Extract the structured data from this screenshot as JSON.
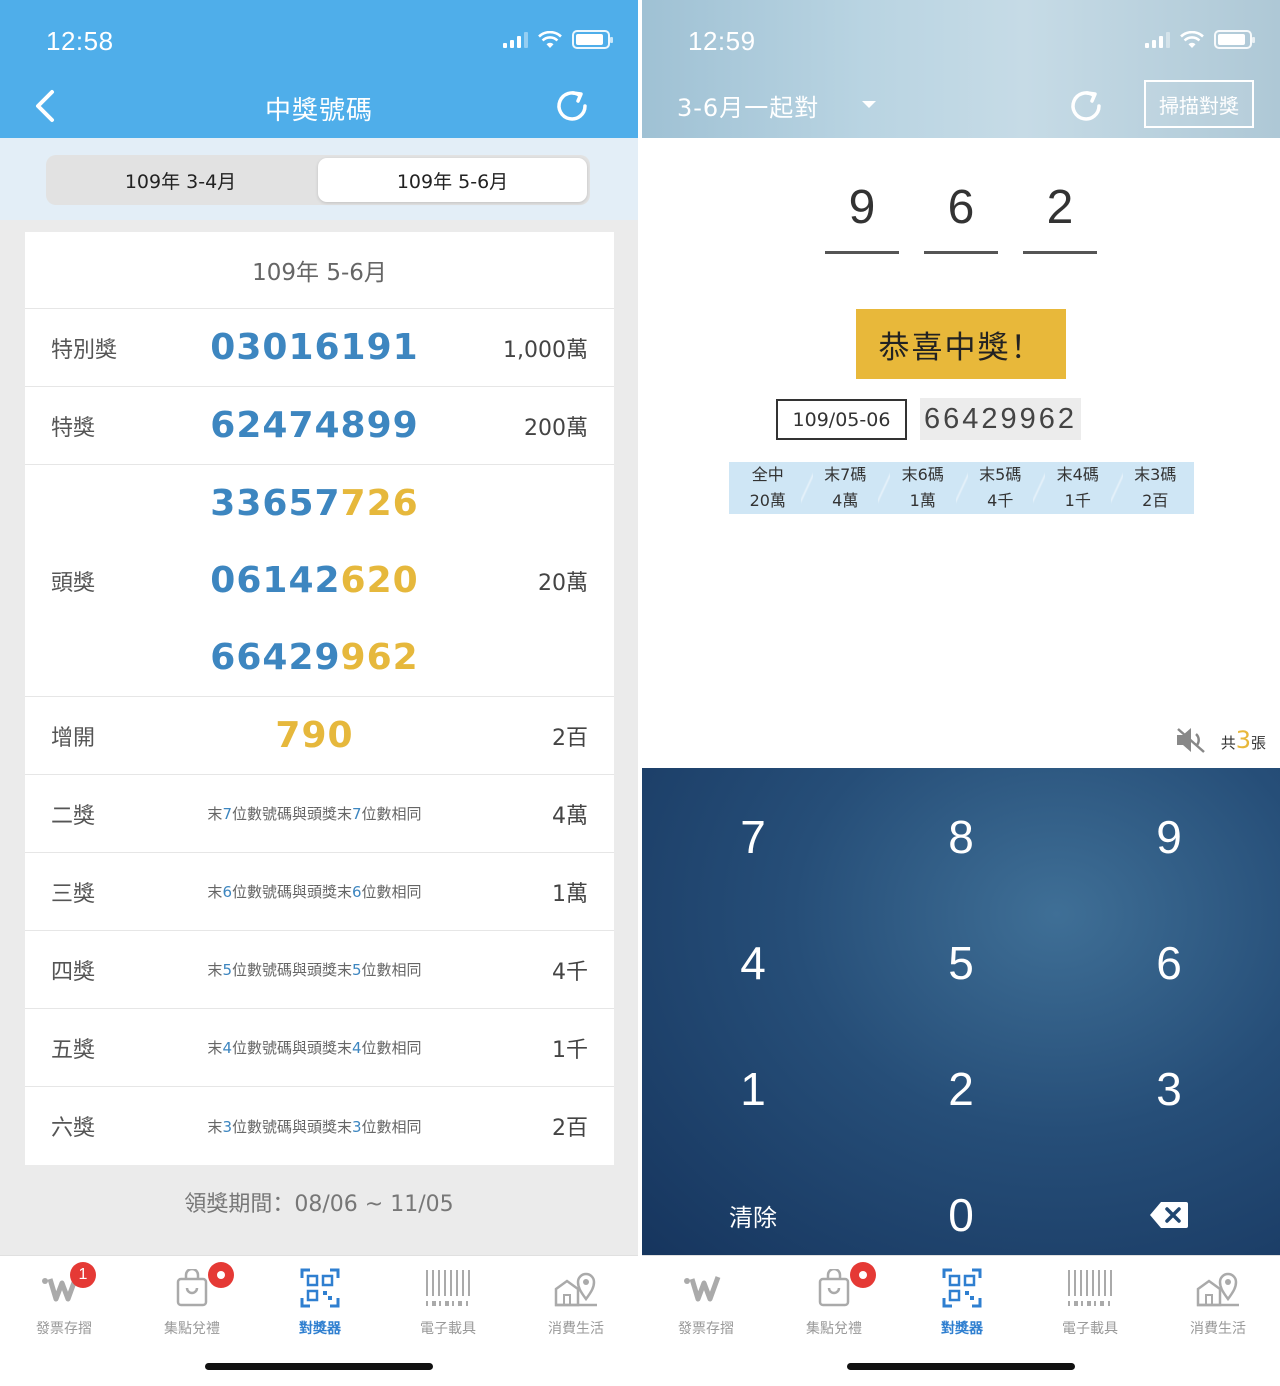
{
  "left": {
    "status_time": "12:58",
    "title": "中獎號碼",
    "segments": [
      "109年 3-4月",
      "109年 5-6月"
    ],
    "period_header": "109年 5-6月",
    "special_prize": {
      "name": "特別獎",
      "number": "03016191",
      "amount": "1,000萬"
    },
    "grand_prize": {
      "name": "特獎",
      "number": "62474899",
      "amount": "200萬"
    },
    "first_prize": {
      "name": "頭獎",
      "amount": "20萬",
      "numbers": [
        {
          "head": "33657",
          "tail": "726"
        },
        {
          "head": "06142",
          "tail": "620"
        },
        {
          "head": "66429",
          "tail": "962"
        }
      ]
    },
    "extra_prize": {
      "name": "增開",
      "number": "790",
      "amount": "2百"
    },
    "desc_prefix": "末",
    "desc_middle": "位數號碼與頭獎末",
    "desc_suffix": "位數相同",
    "lower_prizes": [
      {
        "name": "二獎",
        "digits": "7",
        "amount": "4萬"
      },
      {
        "name": "三獎",
        "digits": "6",
        "amount": "1萬"
      },
      {
        "name": "四獎",
        "digits": "5",
        "amount": "4千"
      },
      {
        "name": "五獎",
        "digits": "4",
        "amount": "1千"
      },
      {
        "name": "六獎",
        "digits": "3",
        "amount": "2百"
      }
    ],
    "claim_period": "領獎期間：08/06 ~ 11/05"
  },
  "right": {
    "status_time": "12:59",
    "period_select": "3-6月一起對",
    "scan_button": "掃描對獎",
    "entered_digits": [
      "9",
      "6",
      "2"
    ],
    "win_banner": "恭喜中獎！",
    "ticket_period": "109/05-06",
    "ticket_number": "66429962",
    "prize_table": [
      {
        "label": "全中",
        "value": "20萬"
      },
      {
        "label": "末7碼",
        "value": "4萬"
      },
      {
        "label": "末6碼",
        "value": "1萬"
      },
      {
        "label": "末5碼",
        "value": "4千"
      },
      {
        "label": "末4碼",
        "value": "1千"
      },
      {
        "label": "末3碼",
        "value": "2百"
      }
    ],
    "counter_prefix": "共",
    "counter_count": "3",
    "counter_suffix": "張",
    "keypad": [
      "7",
      "8",
      "9",
      "4",
      "5",
      "6",
      "1",
      "2",
      "3",
      "清除",
      "0"
    ]
  },
  "tabbar": {
    "tabs": [
      {
        "label": "發票存摺",
        "icon": "invoice-w-icon"
      },
      {
        "label": "集點兌禮",
        "icon": "shopping-bag-icon"
      },
      {
        "label": "對獎器",
        "icon": "qr-scan-icon"
      },
      {
        "label": "電子載具",
        "icon": "barcode-icon"
      },
      {
        "label": "消費生活",
        "icon": "map-pin-icon"
      }
    ],
    "badge_count": "1",
    "active_color": "#2f7fd0"
  },
  "colors": {
    "header_blue": "#4faeea",
    "number_blue": "#3d86c0",
    "gold": "#e6b83c",
    "keypad_navy": "#1f4670"
  }
}
